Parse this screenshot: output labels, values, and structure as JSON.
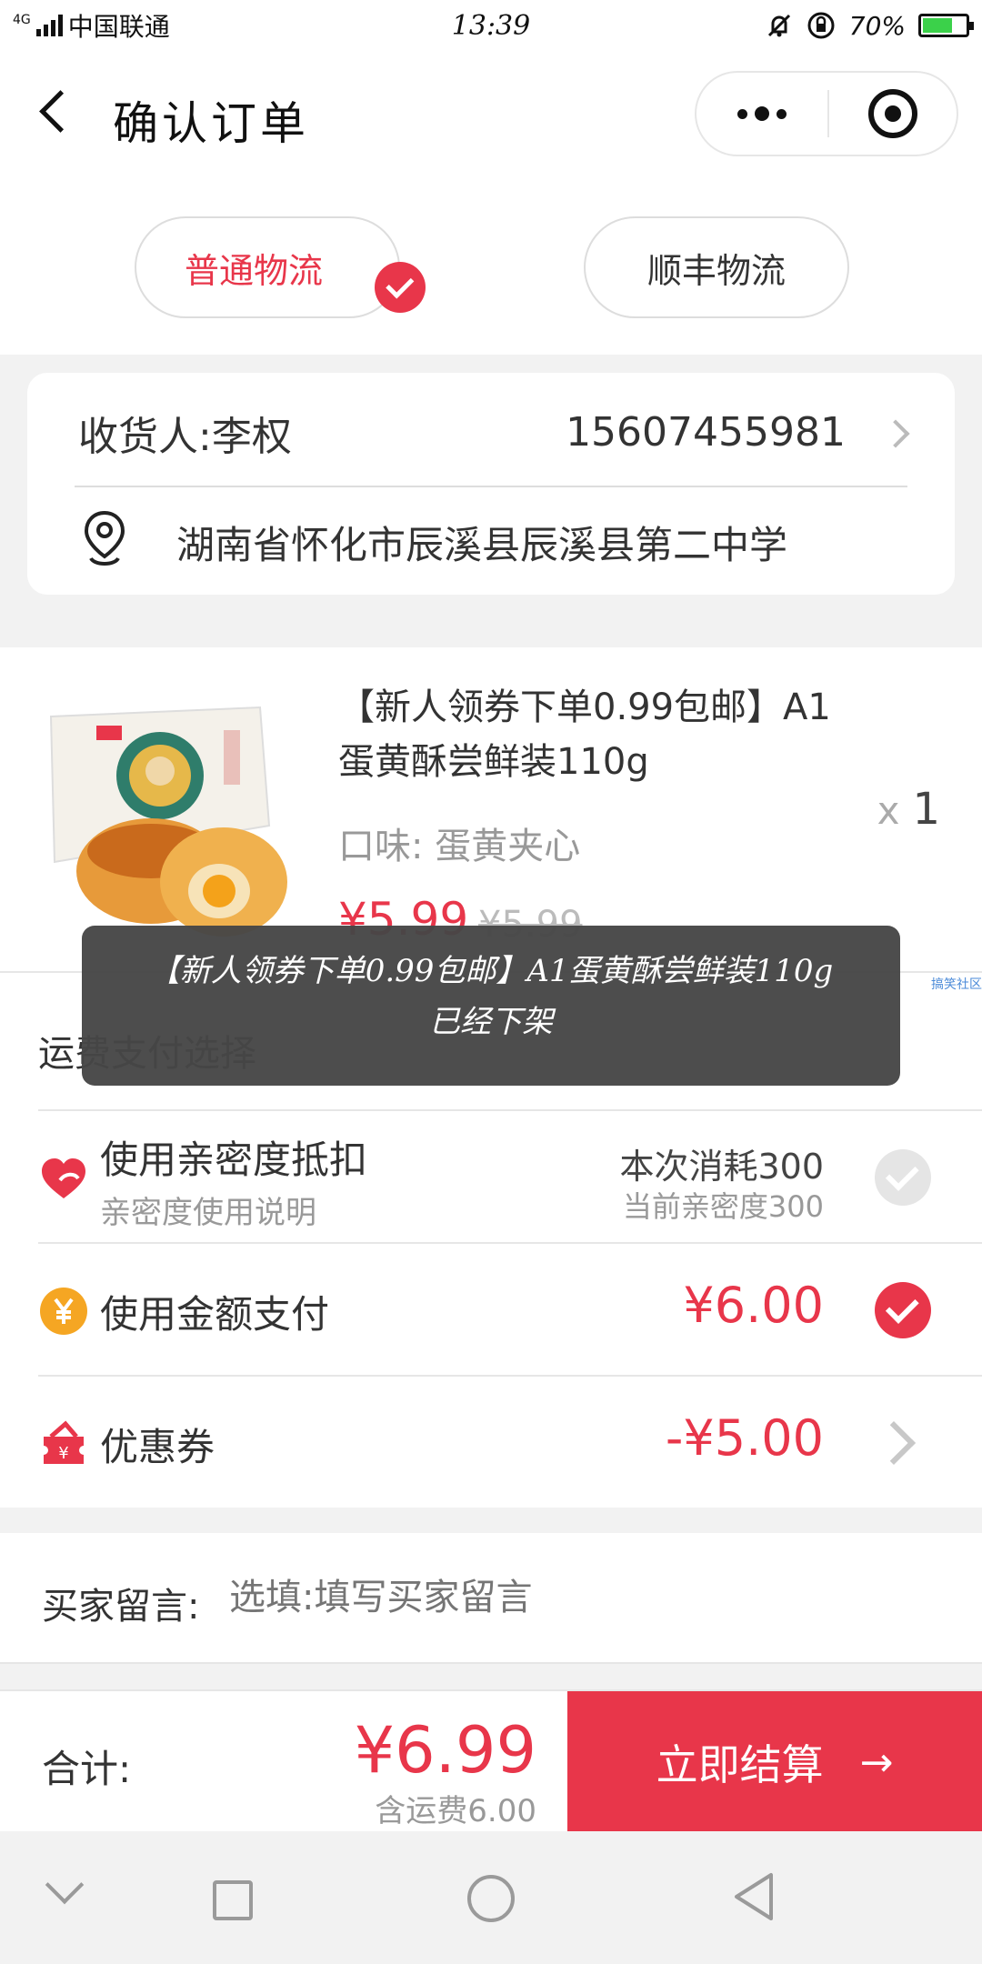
{
  "status_bar": {
    "network": "4G",
    "carrier": "中国联通",
    "time": "13:39",
    "battery_level": "70%",
    "battery_fraction": 0.7
  },
  "nav": {
    "title": "确认订单"
  },
  "logistics": {
    "options": [
      {
        "label": "普通物流",
        "selected": true
      },
      {
        "label": "顺丰物流",
        "selected": false
      }
    ]
  },
  "address": {
    "recipient": "收货人:李权",
    "phone": "15607455981",
    "detail": "湖南省怀化市辰溪县辰溪县第二中学"
  },
  "product": {
    "title": "【新人领券下单0.99包邮】A1蛋黄酥尝鲜装110g",
    "spec": "口味: 蛋黄夹心",
    "qty_prefix": "x",
    "qty": "1",
    "price": "¥5.99",
    "original_price": "¥5.99"
  },
  "payment": {
    "header": "运费支付选择",
    "intimacy": {
      "label": "使用亲密度抵扣",
      "sub": "亲密度使用说明",
      "consume": "本次消耗300",
      "current": "当前亲密度300",
      "checked": false
    },
    "amount": {
      "label": "使用金额支付",
      "value": "¥6.00",
      "checked": true
    },
    "coupon": {
      "label": "优惠券",
      "value": "-¥5.00"
    }
  },
  "message": {
    "label": "买家留言:",
    "placeholder": "选填:填写买家留言"
  },
  "checkout": {
    "label": "合计:",
    "total": "¥6.99",
    "shipping_note": "含运费6.00",
    "button": "立即结算",
    "button_arrow": "→"
  },
  "toast": {
    "text": "【新人领券下单0.99包邮】A1蛋黄酥尝鲜装110g已经下架"
  },
  "watermark": "搞笑社区",
  "colors": {
    "accent": "#e8364a",
    "intimacy_icon": "#e8364a",
    "coin_icon": "#f5a623"
  }
}
